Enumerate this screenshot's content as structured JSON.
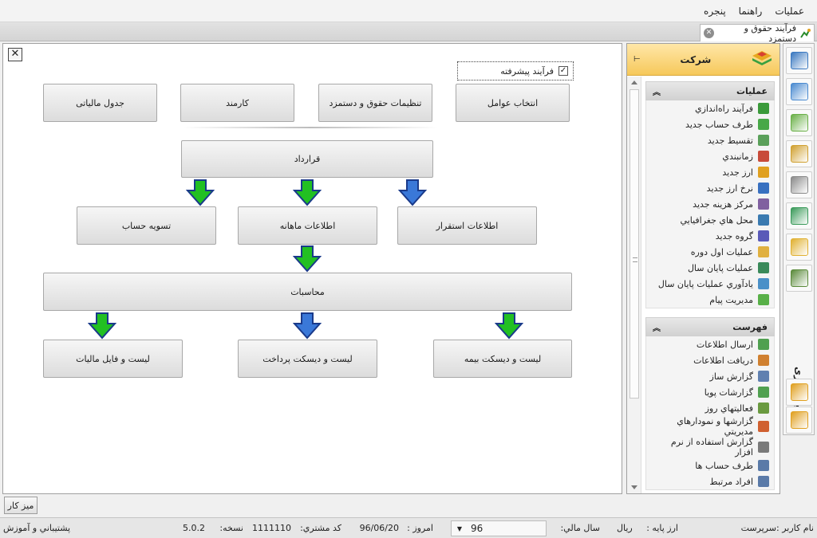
{
  "menu": {
    "items": [
      "عمليات",
      "راهنما",
      "پنجره"
    ]
  },
  "tab": {
    "title": "فرآیند حقوق و دستمزد"
  },
  "canvas": {
    "advanced_label": "فرآیند پیشرفته",
    "advanced_checked": true,
    "top_buttons": [
      "انتخاب عوامل",
      "تنظیمات حقوق و دستمزد",
      "کارمند",
      "جدول مالیاتی"
    ],
    "contract": "قرارداد",
    "mid_buttons": [
      "اطلاعات استقرار",
      "اطلاعات ماهانه",
      "تسویه حساب"
    ],
    "calc": "محاسبات",
    "bottom_buttons": [
      "لیست و دیسکت بیمه",
      "لیست و دیسکت پرداخت",
      "لیست و فایل مالیات"
    ]
  },
  "panel": {
    "title": "شرکت",
    "ops_title": "عمليات",
    "ops_items": [
      {
        "label": "فرآيند راه‌اندازي",
        "icon": "setup-icon",
        "color": "#3a9a3a"
      },
      {
        "label": "طرف حساب جديد",
        "icon": "person-icon",
        "color": "#48a848"
      },
      {
        "label": "تقسيط جديد",
        "icon": "list-icon",
        "color": "#5aa05a"
      },
      {
        "label": "زمانبندي",
        "icon": "calendar-icon",
        "color": "#c84b3a"
      },
      {
        "label": "ارز جديد",
        "icon": "coins-icon",
        "color": "#e0a020"
      },
      {
        "label": "نرخ ارز جديد",
        "icon": "chart-icon",
        "color": "#3870c0"
      },
      {
        "label": "مركز هزينه جديد",
        "icon": "building-icon",
        "color": "#8060a0"
      },
      {
        "label": "محل هاي جغرافيايي",
        "icon": "globe-icon",
        "color": "#3a7ab0"
      },
      {
        "label": "گروه جديد",
        "icon": "group-icon",
        "color": "#5a5ab8"
      },
      {
        "label": "عمليات اول دوره",
        "icon": "pencil-icon",
        "color": "#e0b040"
      },
      {
        "label": "عمليات پايان سال",
        "icon": "book-icon",
        "color": "#3a8a5a"
      },
      {
        "label": "يادآوري عمليات پايان سال",
        "icon": "clock-icon",
        "color": "#4a90c8"
      },
      {
        "label": "مديريت پيام",
        "icon": "message-icon",
        "color": "#58b048"
      }
    ],
    "list_title": "فهرست",
    "list_items": [
      {
        "label": "ارسال اطلاعات",
        "icon": "send-icon",
        "color": "#50a050"
      },
      {
        "label": "دريافت اطلاعات",
        "icon": "receive-icon",
        "color": "#d08030"
      },
      {
        "label": "گزارش ساز",
        "icon": "report-icon",
        "color": "#6080b0"
      },
      {
        "label": "گزارشات پويا",
        "icon": "dynamic-report-icon",
        "color": "#50a050"
      },
      {
        "label": "فعاليتهاي روز",
        "icon": "activity-icon",
        "color": "#6a9a40"
      },
      {
        "label": "گزارشها و نمودارهاي مديريتي",
        "icon": "mgmt-chart-icon",
        "color": "#d06030"
      },
      {
        "label": "گزارش استفاده از نرم افزار",
        "icon": "usage-icon",
        "color": "#7a7a7a"
      },
      {
        "label": "طرف حساب ها",
        "icon": "accounts-icon",
        "color": "#5a7aa8"
      },
      {
        "label": "افراد مرتبط",
        "icon": "people-icon",
        "color": "#5a7aa8"
      }
    ]
  },
  "sidebar": {
    "vertical_label": "پیمانکاری",
    "icons": [
      {
        "name": "reports-module-icon",
        "color": "#3a78c0"
      },
      {
        "name": "sales-module-icon",
        "color": "#4a8ad0"
      },
      {
        "name": "inventory-module-icon",
        "color": "#6ab048"
      },
      {
        "name": "treasury-module-icon",
        "color": "#d0a030"
      },
      {
        "name": "assets-module-icon",
        "color": "#8a8a8a"
      },
      {
        "name": "cash-module-icon",
        "color": "#3a9a5a"
      },
      {
        "name": "accounting-module-icon",
        "color": "#e0b030"
      },
      {
        "name": "payroll-money-icon",
        "color": "#5a8a3a"
      },
      {
        "name": "contracting-module-icon",
        "color": "#3a6ab0"
      },
      {
        "name": "company-module-icon",
        "color": "#e0a020"
      },
      {
        "name": "settings-gear-icon",
        "color": "#e0a020"
      }
    ]
  },
  "bottom": {
    "desk_tab": "ميز كار"
  },
  "status": {
    "user_label": "نام کاربر :",
    "user_value": "سرپرست",
    "currency_label": "ارز پایه :",
    "currency_value": "ریال",
    "year_label": "سال مالي:",
    "year_value": "96",
    "today_label": "امروز :",
    "today_value": "96/06/20",
    "customer_label": "کد مشتري:",
    "customer_value": "1111110",
    "version_label": "نسخه:",
    "version_value": "5.0.2",
    "support": "پشتيباني و آموزش"
  }
}
